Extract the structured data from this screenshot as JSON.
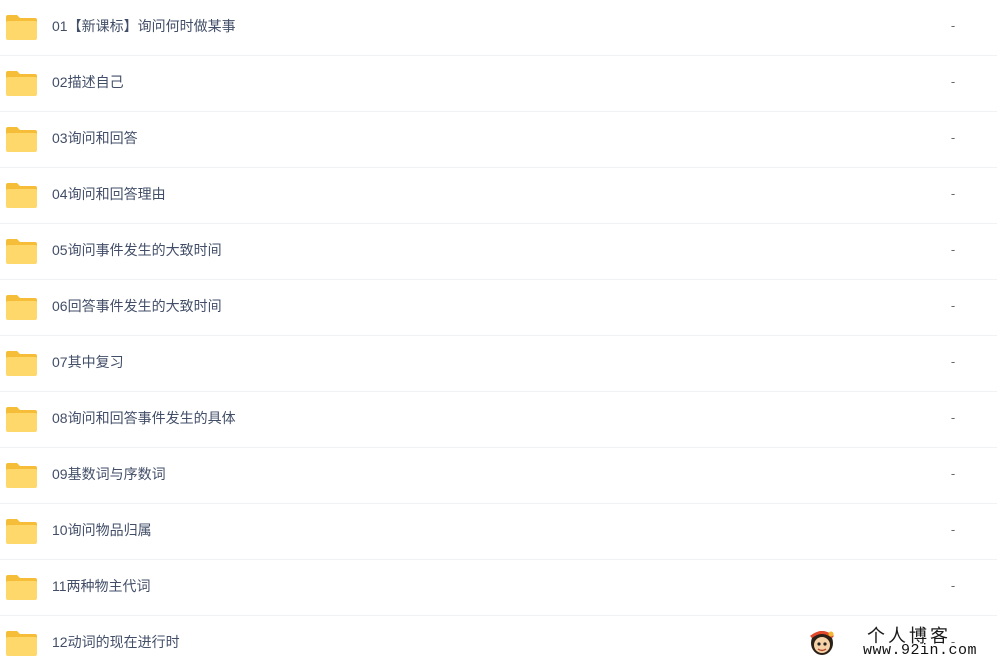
{
  "files": [
    {
      "name": "01【新课标】询问何时做某事",
      "size": "-"
    },
    {
      "name": "02描述自己",
      "size": "-"
    },
    {
      "name": "03询问和回答",
      "size": "-"
    },
    {
      "name": "04询问和回答理由",
      "size": "-"
    },
    {
      "name": "05询问事件发生的大致时间",
      "size": "-"
    },
    {
      "name": "06回答事件发生的大致时间",
      "size": "-"
    },
    {
      "name": "07其中复习",
      "size": "-"
    },
    {
      "name": "08询问和回答事件发生的具体",
      "size": "-"
    },
    {
      "name": "09基数词与序数词",
      "size": "-"
    },
    {
      "name": "10询问物品归属",
      "size": "-"
    },
    {
      "name": "11两种物主代词",
      "size": "-"
    },
    {
      "name": "12动词的现在进行时",
      "size": "-"
    }
  ],
  "icons": {
    "folder": "folder-icon",
    "watermark_avatar": "cartoon-avatar-icon"
  },
  "colors": {
    "folder_body": "#ffd86b",
    "folder_tab": "#f5bd38",
    "text": "#424e67",
    "divider": "#f1f2f4"
  },
  "watermark": {
    "title": "个人博客",
    "url": "www.92in.com"
  }
}
